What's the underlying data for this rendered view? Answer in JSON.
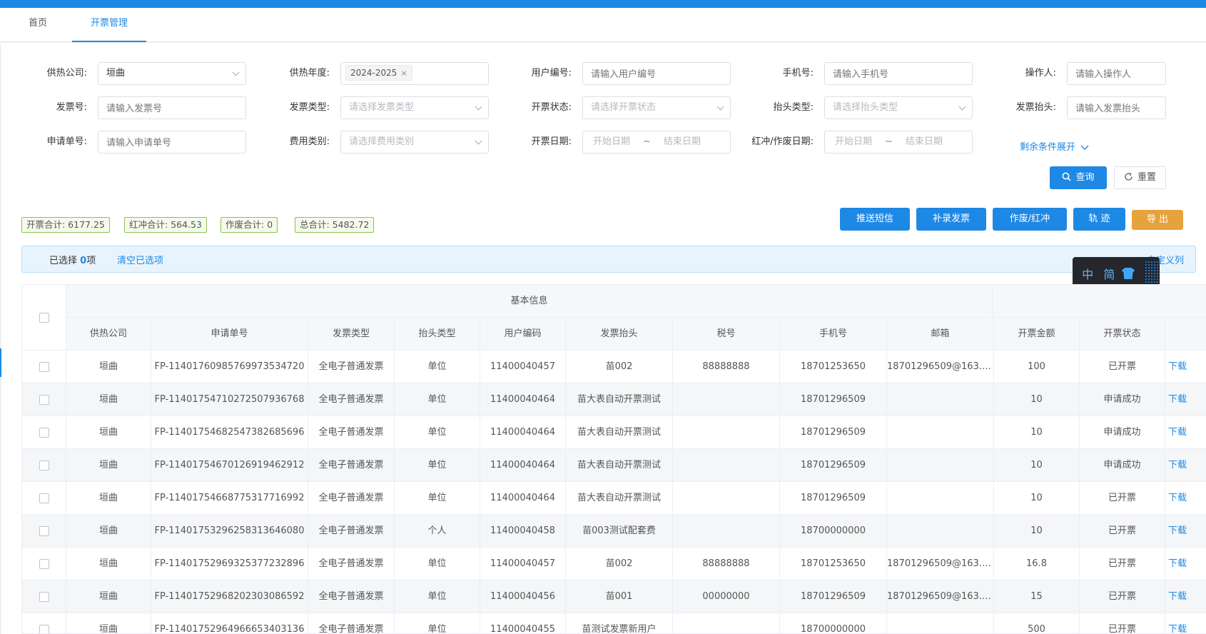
{
  "tabs": [
    {
      "label": "首页"
    },
    {
      "label": "开票管理"
    }
  ],
  "filters": {
    "company_label": "供热公司:",
    "company_value": "垣曲",
    "year_label": "供热年度:",
    "year_tag": "2024-2025",
    "year_tag_close": "×",
    "user_no_label": "用户编号:",
    "user_no_placeholder": "请输入用户编号",
    "phone_label": "手机号:",
    "phone_placeholder": "请输入手机号",
    "operator_label": "操作人:",
    "operator_placeholder": "请输入操作人",
    "invoice_no_label": "发票号:",
    "invoice_no_placeholder": "请输入发票号",
    "invoice_type_label": "发票类型:",
    "invoice_type_placeholder": "请选择发票类型",
    "status_label": "开票状态:",
    "status_placeholder": "请选择开票状态",
    "header_type_label": "抬头类型:",
    "header_type_placeholder": "请选择抬头类型",
    "invoice_header_label": "发票抬头:",
    "invoice_header_placeholder": "请输入发票抬头",
    "apply_no_label": "申请单号:",
    "apply_no_placeholder": "请输入申请单号",
    "fee_type_label": "费用类别:",
    "fee_type_placeholder": "请选择费用类别",
    "date_label": "开票日期:",
    "date_start": "开始日期",
    "date_sep": "~",
    "date_end": "结束日期",
    "redvoid_date_label": "红冲/作废日期:",
    "redvoid_start": "开始日期",
    "redvoid_end": "结束日期",
    "expand_link": "剩余条件展开"
  },
  "buttons": {
    "query": "查询",
    "reset": "重置",
    "push_sms": "推送短信",
    "supplement": "补录发票",
    "void_red": "作废/红冲",
    "track": "轨 迹",
    "export": "导 出"
  },
  "summary": {
    "issued": "开票合计: 6177.25",
    "red": "红冲合计: 564.53",
    "void": "作废合计: 0",
    "total": "总合计: 5482.72"
  },
  "selection": {
    "prefix": "已选择",
    "count": "0",
    "suffix": "项",
    "clear": "清空已选项",
    "custom_columns": "自定义列"
  },
  "ime": {
    "chinese": "中",
    "simplified": "简"
  },
  "table": {
    "group_header": "基本信息",
    "columns": [
      "供热公司",
      "申请单号",
      "发票类型",
      "抬头类型",
      "用户编码",
      "发票抬头",
      "税号",
      "手机号",
      "邮箱",
      "开票金额",
      "开票状态"
    ],
    "action_label": "下载",
    "rows": [
      [
        "垣曲",
        "FP-1140176098576997353472​0",
        "全电子普通发票",
        "单位",
        "11400040457",
        "苗002",
        "88888888",
        "18701253650",
        "18701296509@163.c...",
        "100",
        "已开票"
      ],
      [
        "垣曲",
        "FP-1140175471027250793676​8",
        "全电子普通发票",
        "单位",
        "11400040464",
        "苗大表自动开票测试",
        "",
        "18701296509",
        "",
        "10",
        "申请成功"
      ],
      [
        "垣曲",
        "FP-1140175468254738268569​6",
        "全电子普通发票",
        "单位",
        "11400040464",
        "苗大表自动开票测试",
        "",
        "18701296509",
        "",
        "10",
        "申请成功"
      ],
      [
        "垣曲",
        "FP-1140175467012691946291​2",
        "全电子普通发票",
        "单位",
        "11400040464",
        "苗大表自动开票测试",
        "",
        "18701296509",
        "",
        "10",
        "申请成功"
      ],
      [
        "垣曲",
        "FP-1140175466877531771699​2",
        "全电子普通发票",
        "单位",
        "11400040464",
        "苗大表自动开票测试",
        "",
        "18701296509",
        "",
        "10",
        "已开票"
      ],
      [
        "垣曲",
        "FP-1140175329625831364608​0",
        "全电子普通发票",
        "个人",
        "11400040458",
        "苗003测试配套费",
        "",
        "18700000000",
        "",
        "10",
        "已开票"
      ],
      [
        "垣曲",
        "FP-1140175296932537723289​6",
        "全电子普通发票",
        "单位",
        "11400040457",
        "苗002",
        "88888888",
        "18701253650",
        "18701296509@163.c...",
        "16.8",
        "已开票"
      ],
      [
        "垣曲",
        "FP-1140175296820230308659​2",
        "全电子普通发票",
        "单位",
        "11400040456",
        "苗001",
        "00000000",
        "18701296509",
        "18701296509@163.c...",
        "15",
        "已开票"
      ],
      [
        "垣曲",
        "FP-1140175296496665340313​6",
        "全电子普通发票",
        "单位",
        "11400040455",
        "苗测试发票新用户",
        "",
        "18700000000",
        "",
        "500",
        "已开票"
      ]
    ]
  },
  "colors": {
    "primary": "#1e88e5",
    "warning": "#e6a23c",
    "summary_border": "#8bc34a"
  }
}
